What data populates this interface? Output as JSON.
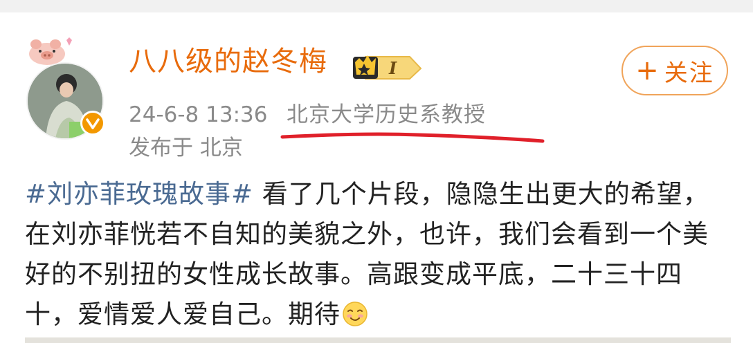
{
  "user": {
    "name": "八八级的赵冬梅",
    "vip_level": "I",
    "verified": true
  },
  "follow_button": {
    "plus": "+",
    "label": "关注"
  },
  "meta": {
    "time": "24-6-8 13:36",
    "title": "北京大学历史系教授",
    "location": "发布于 北京"
  },
  "post": {
    "hashtag": "#刘亦菲玫瑰故事#",
    "text": " 看了几个片段，隐隐生出更大的希望，在刘亦菲恍若不自知的美貌之外，也许，我们会看到一个美好的不别扭的女性成长故事。高跟变成平底，二十三十四十，爱情爱人爱自己。期待",
    "emoji": "smile-emoji"
  },
  "colors": {
    "username": "#e86b0c",
    "hashtag": "#4a6a92",
    "meta": "#8a8a8a",
    "underline": "#e0202a",
    "verified_badge": "#f39800"
  }
}
